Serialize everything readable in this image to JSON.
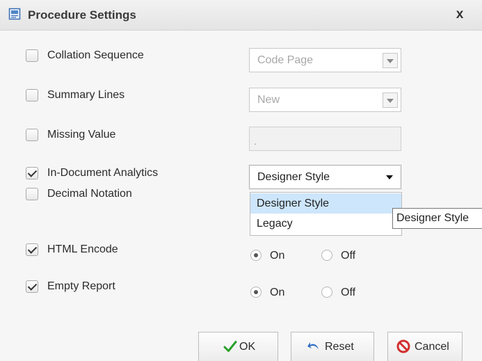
{
  "window": {
    "title": "Procedure Settings",
    "close_label": "x"
  },
  "options": [
    {
      "label": "Collation Sequence",
      "checked": false
    },
    {
      "label": "Summary Lines",
      "checked": false
    },
    {
      "label": "Missing Value",
      "checked": false
    },
    {
      "label": "In-Document Analytics",
      "checked": true
    },
    {
      "label": "Decimal Notation",
      "checked": false
    },
    {
      "label": "HTML Encode",
      "checked": true
    },
    {
      "label": "Empty Report",
      "checked": true
    }
  ],
  "collation_select": {
    "value": "Code Page"
  },
  "summary_select": {
    "value": "New"
  },
  "missing_value_input": {
    "value": "."
  },
  "analytics_select": {
    "value": "Designer Style",
    "options": [
      "Designer Style",
      "Legacy"
    ],
    "tooltip": "Designer Style"
  },
  "html_encode": {
    "on_label": "On",
    "off_label": "Off",
    "selected": "On"
  },
  "empty_report": {
    "on_label": "On",
    "off_label": "Off",
    "selected": "On"
  },
  "buttons": {
    "ok": "OK",
    "reset": "Reset",
    "cancel": "Cancel"
  },
  "colors": {
    "ok_check": "#2aa02a",
    "reset_arrow": "#2f6fc4",
    "cancel_icon": "#d32f2f",
    "highlight": "#cde6fb"
  }
}
